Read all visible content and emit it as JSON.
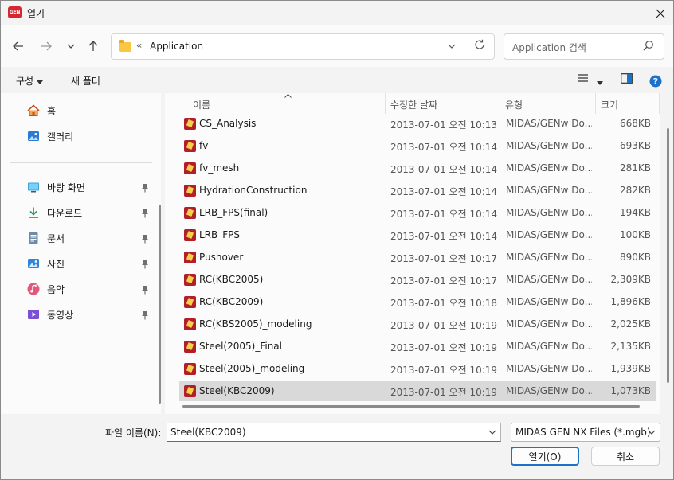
{
  "window": {
    "title": "열기",
    "app_logo_text": "GEN"
  },
  "nav": {
    "breadcrumb_sep": "«",
    "address": "Application",
    "search_placeholder": "Application 검색"
  },
  "toolbar": {
    "organize": "구성",
    "new_folder": "새 폴더"
  },
  "sidebar": {
    "top_items": [
      {
        "label": "홈",
        "icon": "home-icon"
      },
      {
        "label": "갤러리",
        "icon": "gallery-icon"
      }
    ],
    "pinned_items": [
      {
        "label": "바탕 화면",
        "icon": "desktop-icon"
      },
      {
        "label": "다운로드",
        "icon": "download-icon"
      },
      {
        "label": "문서",
        "icon": "documents-icon"
      },
      {
        "label": "사진",
        "icon": "pictures-icon"
      },
      {
        "label": "음악",
        "icon": "music-icon"
      },
      {
        "label": "동영상",
        "icon": "videos-icon"
      }
    ]
  },
  "columns": {
    "name": "이름",
    "date": "수정한 날짜",
    "type": "유형",
    "size": "크기"
  },
  "files": [
    {
      "name": "CS_Analysis",
      "date": "2013-07-01 오전 10:13",
      "type": "MIDAS/GENw Do...",
      "size": "668KB"
    },
    {
      "name": "fv",
      "date": "2013-07-01 오전 10:14",
      "type": "MIDAS/GENw Do...",
      "size": "693KB"
    },
    {
      "name": "fv_mesh",
      "date": "2013-07-01 오전 10:14",
      "type": "MIDAS/GENw Do...",
      "size": "281KB"
    },
    {
      "name": "HydrationConstruction",
      "date": "2013-07-01 오전 10:14",
      "type": "MIDAS/GENw Do...",
      "size": "282KB"
    },
    {
      "name": "LRB_FPS(final)",
      "date": "2013-07-01 오전 10:14",
      "type": "MIDAS/GENw Do...",
      "size": "194KB"
    },
    {
      "name": "LRB_FPS",
      "date": "2013-07-01 오전 10:14",
      "type": "MIDAS/GENw Do...",
      "size": "100KB"
    },
    {
      "name": "Pushover",
      "date": "2013-07-01 오전 10:17",
      "type": "MIDAS/GENw Do...",
      "size": "890KB"
    },
    {
      "name": "RC(KBC2005)",
      "date": "2013-07-01 오전 10:17",
      "type": "MIDAS/GENw Do...",
      "size": "2,309KB"
    },
    {
      "name": "RC(KBC2009)",
      "date": "2013-07-01 오전 10:18",
      "type": "MIDAS/GENw Do...",
      "size": "1,896KB"
    },
    {
      "name": "RC(KBS2005)_modeling",
      "date": "2013-07-01 오전 10:19",
      "type": "MIDAS/GENw Do...",
      "size": "2,025KB"
    },
    {
      "name": "Steel(2005)_Final",
      "date": "2013-07-01 오전 10:19",
      "type": "MIDAS/GENw Do...",
      "size": "2,135KB"
    },
    {
      "name": "Steel(2005)_modeling",
      "date": "2013-07-01 오전 10:19",
      "type": "MIDAS/GENw Do...",
      "size": "1,939KB"
    },
    {
      "name": "Steel(KBC2009)",
      "date": "2013-07-01 오전 10:19",
      "type": "MIDAS/GENw Do...",
      "size": "1,073KB",
      "selected": true
    }
  ],
  "footer": {
    "filename_label": "파일 이름(N):",
    "filename_value": "Steel(KBC2009)",
    "filetype_value": "MIDAS GEN NX Files (*.mgb)",
    "open_button": "열기(O)",
    "cancel_button": "취소"
  },
  "colors": {
    "accent": "#1a73c9",
    "selected_row": "#d9d9d9",
    "logo": "#d7262f",
    "folder": "#f8c744"
  }
}
